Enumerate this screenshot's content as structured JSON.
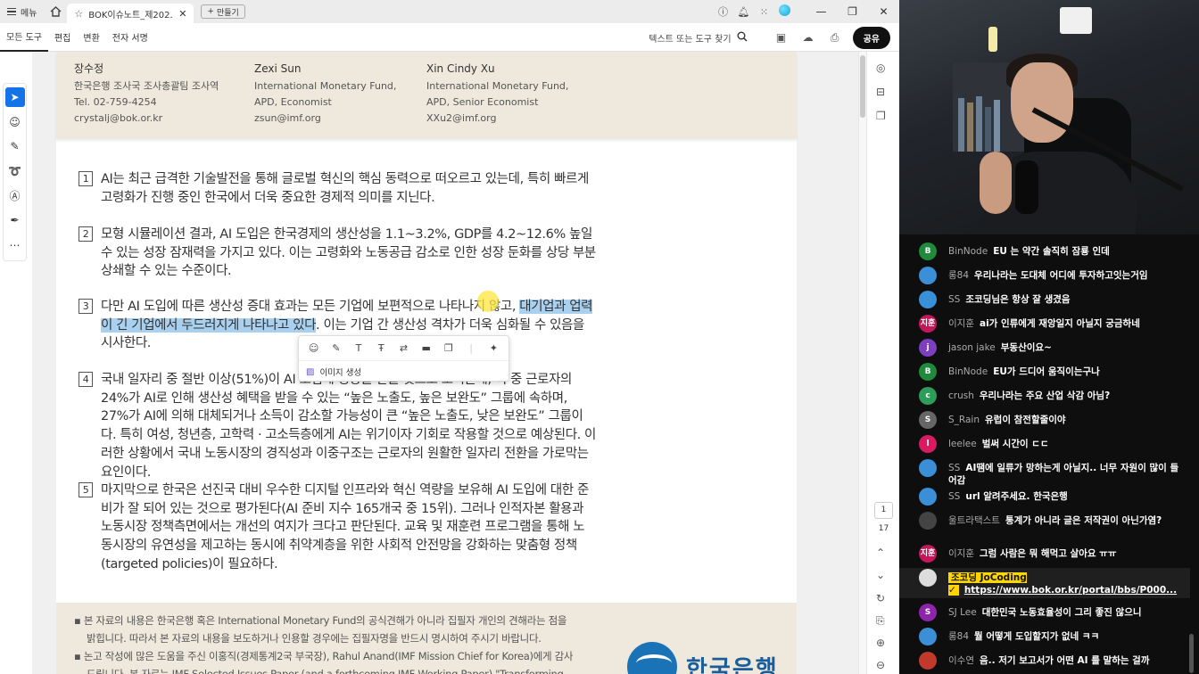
{
  "titlebar": {
    "menu_label": "메뉴",
    "tab_title": "BOK이슈노트_제202...",
    "new_tab_label": "만들기"
  },
  "toolbar": {
    "tools": [
      "모든 도구",
      "편집",
      "변환",
      "전자 서명"
    ],
    "search_label": "텍스트 또는 도구 찾기",
    "share_label": "공유"
  },
  "authors": [
    {
      "name": "장수정",
      "lines": [
        "한국은행 조사국 조사총괄팀 조사역",
        "Tel. 02-759-4254",
        "crystalj@bok.or.kr"
      ]
    },
    {
      "name": "Zexi Sun",
      "lines": [
        "International Monetary Fund,",
        "APD, Economist",
        "zsun@imf.org"
      ]
    },
    {
      "name": "Xin Cindy Xu",
      "lines": [
        "International Monetary Fund,",
        "APD, Senior Economist",
        "XXu2@imf.org"
      ]
    }
  ],
  "paragraphs": [
    {
      "num": "1",
      "text": "AI는 최근 급격한 기술발전을 통해 글로벌 혁신의 핵심 동력으로 떠오르고 있는데, 특히 빠르게 고령화가 진행 중인 한국에서 더욱 중요한 경제적 의미를 지닌다."
    },
    {
      "num": "2",
      "text": "모형 시뮬레이션 결과, AI 도입은 한국경제의 생산성을 1.1~3.2%, GDP를 4.2~12.6% 높일 수 있는 성장 잠재력을 가지고 있다. 이는 고령화와 노동공급 감소로 인한 성장 둔화를 상당 부분 상쇄할 수 있는 수준이다."
    },
    {
      "num": "3",
      "text_before": "다만 AI 도입에 따른 생산성 증대 효과는 모든 기업에 보편적으로 나타나지 않고, ",
      "text_hl": "대기업과 업력이 긴 기업에서 두드러지게 나타나고 있다",
      "text_after": ". 이는 기업 간 생산성 격차가 더욱 심화될 수 있음을 시사한다."
    },
    {
      "num": "4",
      "text": "국내 일자리 중 절반 이상(51%)이 AI 도입에 영향을 받을 것으로 보이는데, 이 중 근로자의 24%가 AI로 인해 생산성 혜택을 받을 수 있는 “높은 노출도, 높은 보완도” 그룹에 속하며, 27%가 AI에 의해 대체되거나 소득이 감소할 가능성이 큰 “높은 노출도, 낮은 보완도” 그룹이다. 특히 여성, 청년층, 고학력 · 고소득층에게 AI는 위기이자 기회로 작용할 것으로 예상된다. 이러한 상황에서 국내 노동시장의 경직성과 이중구조는 근로자의 원활한 일자리 전환을 가로막는 요인이다."
    },
    {
      "num": "5",
      "text": "마지막으로 한국은 선진국 대비 우수한 디지털 인프라와 혁신 역량을 보유해 AI 도입에 대한 준비가 잘 되어 있는 것으로 평가된다(AI 준비 지수 165개국 중 15위). 그러나 인적자본 활용과 노동시장 정책측면에서는 개선의 여지가 크다고 판단된다. 교육 및 재훈련 프로그램을 통해 노동시장의 유연성을 제고하는 동시에 취약계층을 위한 사회적 안전망을 강화하는 맞춤형 정책(targeted policies)이 필요하다."
    }
  ],
  "floating_toolbar": {
    "gen_label": "이미지 생성"
  },
  "footer": {
    "line1": "본 자료의 내용은 한국은행 혹은 International Monetary Fund의 공식견해가 아니라 집필자 개인의 견해라는 점을",
    "line2": "밝힙니다. 따라서 본 자료의 내용을 보도하거나 인용할 경우에는 집필자명을 반드시 명시하여 주시기 바랍니다.",
    "line3": "논고 작성에 많은 도움을 주신 이홍직(경제통계2국 부국장), Rahul Anand(IMF Mission Chief for Korea)에게 감사",
    "line4": "드립니다. 본 자료는 IMF Selected Issues Paper (and a forthcoming IMF Working Paper) \"Transforming",
    "logo_text": "한국은행"
  },
  "page_nav": {
    "current": "1",
    "total": "17"
  },
  "chat": [
    {
      "avatar": "B",
      "color": "#1f8a3c",
      "author": "BinNode",
      "text": "EU 는 약간 솔직히 잠룡 인데"
    },
    {
      "avatar": "",
      "color": "#3a8fd6",
      "author": "롱84",
      "text": "우리나라는 도대체 어디에 투자하고잇는거임"
    },
    {
      "avatar": "",
      "color": "#3a8fd6",
      "author": "SS",
      "text": "조코딩님은 항상 잘 생겼음"
    },
    {
      "avatar": "지훈",
      "color": "#c2185b",
      "author": "이지훈",
      "text": "ai가 인류에게 재앙일지 아닐지 궁금하네"
    },
    {
      "avatar": "j",
      "color": "#7b3fc0",
      "author": "jason jake",
      "text": "부동산이요~"
    },
    {
      "avatar": "B",
      "color": "#1f8a3c",
      "author": "BinNode",
      "text": "EU가 드디어 움직이는구나"
    },
    {
      "avatar": "c",
      "color": "#2e9d5a",
      "author": "crush",
      "text": "우리나라는 주요 산업 삭감 아님?"
    },
    {
      "avatar": "S",
      "color": "#666",
      "author": "S_Rain",
      "text": "유럽이 참전할줄이야"
    },
    {
      "avatar": "l",
      "color": "#d81b60",
      "author": "leelee",
      "text": "벌써 시간이 ㄷㄷ"
    },
    {
      "avatar": "",
      "color": "#3a8fd6",
      "author": "SS",
      "text": "AI땜에 일류가 망하는게 아닐지.. 너무 자원이 많이 들어감"
    },
    {
      "avatar": "",
      "color": "#3a8fd6",
      "author": "SS",
      "text": "url 알려주세요. 한국은행"
    },
    {
      "avatar": "",
      "color": "#444",
      "author": "울트라택스트",
      "text": "통계가 아니라 글은 저작권이 아닌가염?"
    },
    {
      "avatar": "지훈",
      "color": "#c2185b",
      "author": "이지훈",
      "text": "그럼 사람은 뭐 해먹고 살아요 ㅠㅠ"
    },
    {
      "avatar": "",
      "color": "#dddddd",
      "author": "조코딩 JoCoding ✓",
      "text": "https://www.bok.or.kr/portal/bbs/P000...",
      "owner": true
    },
    {
      "avatar": "S",
      "color": "#8e24aa",
      "author": "SJ Lee",
      "text": "대한민국 노동효율성이 그리 좋진 않으니"
    },
    {
      "avatar": "",
      "color": "#3a8fd6",
      "author": "롱84",
      "text": "뭘 어떻게 도입할지가 없네 ㅋㅋ"
    },
    {
      "avatar": "",
      "color": "#c0392b",
      "author": "이수연",
      "text": "음.. 저기 보고서가 어떤 AI 를 말하는 걸까"
    }
  ]
}
